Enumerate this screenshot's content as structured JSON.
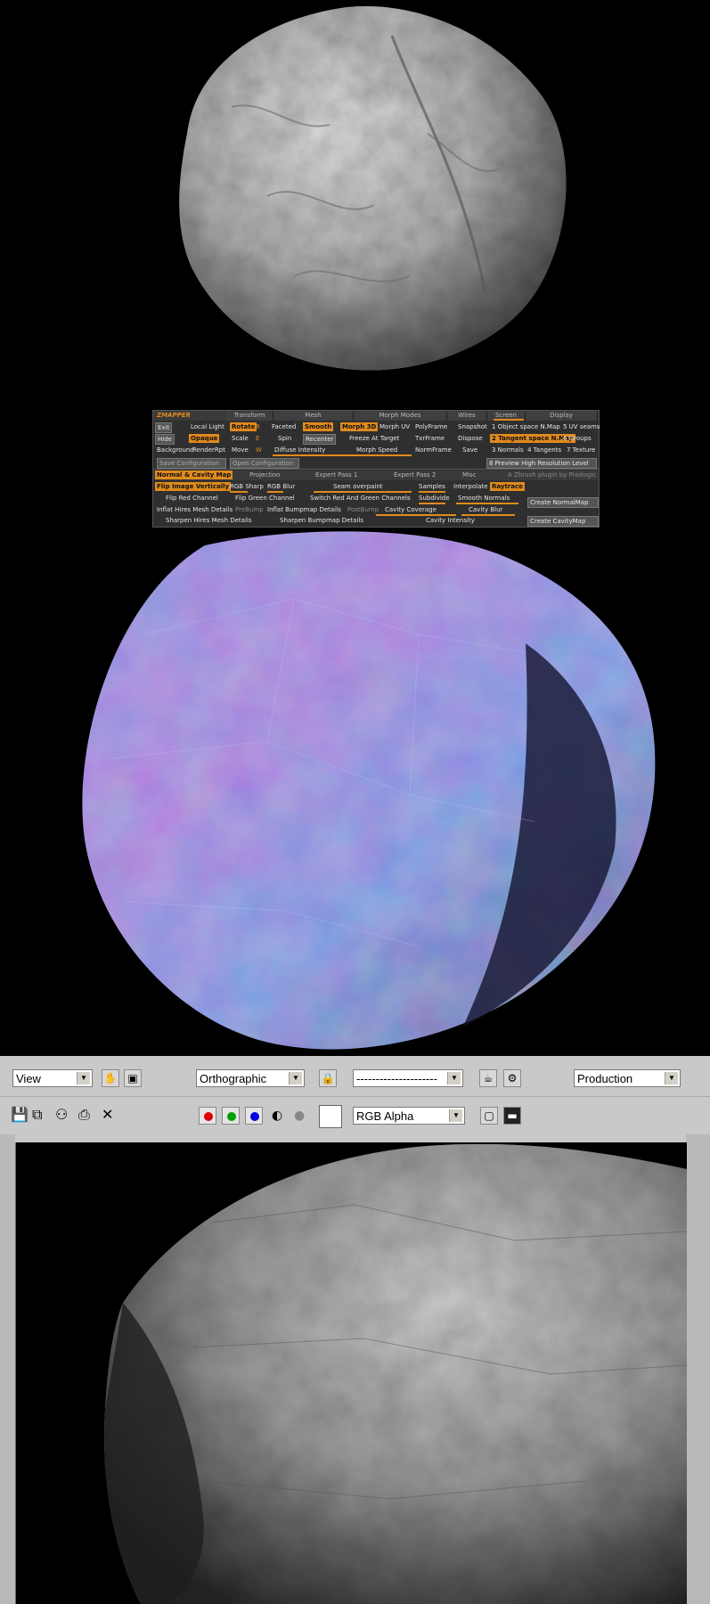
{
  "zmapper": {
    "logo": "ZMAPPER",
    "tabs": [
      "Transform",
      "Mesh",
      "Morph Modes",
      "Wires",
      "Screen",
      "Display"
    ],
    "row1": [
      "Exit",
      "Local Light",
      "Rotate",
      "R",
      "Faceted",
      "Smooth",
      "Morph 3D",
      "Morph UV",
      "PolyFrame",
      "Snapshot",
      "1 Object space N.Map",
      "5 UV seams"
    ],
    "row2": [
      "Hide",
      "Opaque",
      "Scale",
      "E",
      "Spin",
      "Recenter",
      "Freeze At Target",
      "TxrFrame",
      "Dispose",
      "2 Tangent space N.Map",
      "6 Groups"
    ],
    "row3": [
      "Background",
      "RenderRpt",
      "Move",
      "W",
      "Diffuse Intensity",
      "Morph Speed",
      "NormFrame",
      "Save",
      "3 Normals",
      "4 Tangents",
      "7 Texture"
    ],
    "row4": [
      "Save Configuration",
      "Open Configuration",
      "8 Preview High Resolution Level"
    ],
    "subtabs": [
      "Normal & Cavity Map",
      "Projection",
      "Expert Pass 1",
      "Expert Pass 2",
      "Misc",
      "A Zbrush plugin by Pixologic"
    ],
    "row5": [
      "Flip Image Vertically",
      "RGB Sharp",
      "RGB Blur",
      "Seam overpaint",
      "Samples",
      "Interpolate",
      "Raytrace"
    ],
    "row6": [
      "Flip Red Channel",
      "Flip Green Channel",
      "Switch Red And Green Channels",
      "Subdivide",
      "Smooth Normals",
      "Create NormalMap"
    ],
    "row7": [
      "Inflat Hires Mesh Details",
      "PreBump",
      "Inflat Bumpmap Details",
      "PostBump",
      "Cavity Coverage",
      "Cavity Blur"
    ],
    "row8": [
      "Sharpen Hires Mesh Details",
      "Sharpen Bumpmap Details",
      "Cavity Intensity",
      "Create CavityMap"
    ]
  },
  "viewport": {
    "view_select": "View",
    "projection_select": "Orthographic",
    "layer_select": "---------------------",
    "preset_select": "Production",
    "channel_select": "RGB Alpha"
  },
  "colors": {
    "accent": "#e08a1e",
    "panel_bg": "#2f2f2f",
    "toolbar_bg": "#c9c9c9",
    "channel_red": "#e00000",
    "channel_green": "#00a000",
    "channel_blue": "#0000e0"
  },
  "icons": [
    "lock-icon",
    "hand-icon",
    "frame-icon",
    "teapot-icon",
    "gear-icon",
    "save-icon",
    "copy-icon",
    "clone-icon",
    "print-icon",
    "close-icon",
    "mono-icon",
    "alpha-icon",
    "white-swatch-icon",
    "region-icon",
    "display-icon"
  ]
}
